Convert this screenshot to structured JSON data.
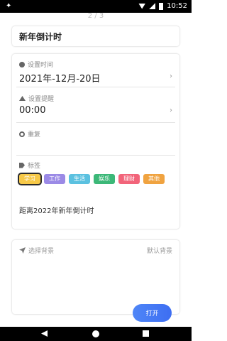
{
  "status_bar": {
    "time": "10:52",
    "left_icon": "app-notification-icon"
  },
  "page_indicator": "2 / 3",
  "title_field": {
    "value": "新年倒计时"
  },
  "settings": {
    "time_label": "设置时间",
    "date_value": "2021年-12月-20日",
    "reminder_label": "设置提醒",
    "reminder_value": "00:00",
    "repeat_label": "重复",
    "tags_label": "标签",
    "tags": [
      {
        "label": "学习",
        "color": "#f7c948",
        "selected": true
      },
      {
        "label": "工作",
        "color": "#9b8ae6",
        "selected": false
      },
      {
        "label": "生活",
        "color": "#5bc1e0",
        "selected": false
      },
      {
        "label": "娱乐",
        "color": "#3cb878",
        "selected": false
      },
      {
        "label": "理财",
        "color": "#f2647a",
        "selected": false
      },
      {
        "label": "其他",
        "color": "#f0a340",
        "selected": false
      }
    ],
    "countdown_text": "距离2022年新年倒计时"
  },
  "background": {
    "label": "选择背景",
    "default_label": "默认背景",
    "open_button": "打开"
  }
}
